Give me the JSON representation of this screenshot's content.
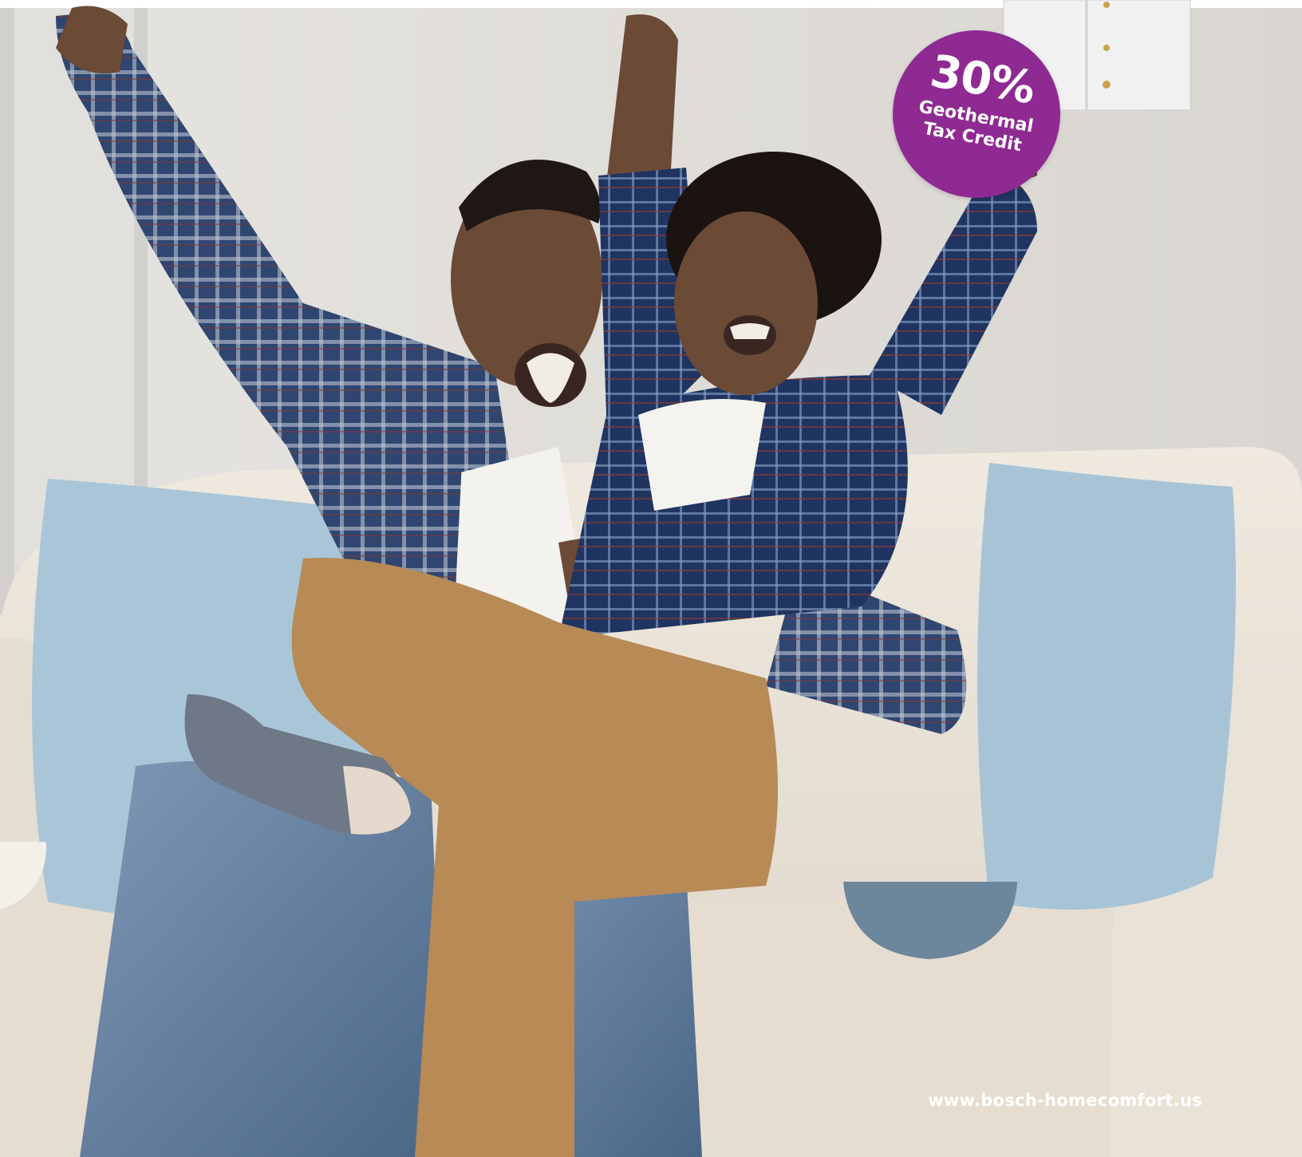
{
  "badge": {
    "percent": "30%",
    "line1": "Geothermal",
    "line2": "Tax Credit",
    "color": "#8f2a93"
  },
  "footer": {
    "url": "www.bosch-homecomfort.us"
  },
  "photo": {
    "wall_color": "#dedcd8",
    "sofa_color": "#ece6dc",
    "pillow_color": "#a9c6d8"
  }
}
